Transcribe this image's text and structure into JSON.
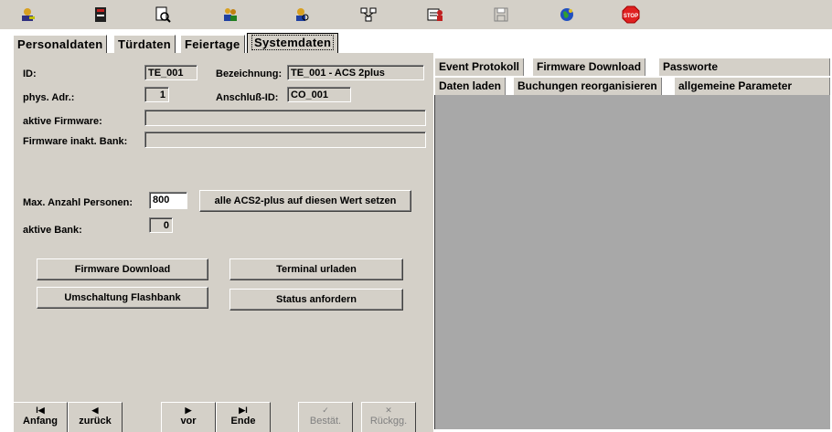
{
  "toolbar": {
    "icons": [
      "people-key-icon",
      "book-icon",
      "print-preview-icon",
      "persons-icon",
      "person-search-icon",
      "network-icon",
      "user-card-icon",
      "save-disk-icon",
      "globe-icon",
      "stop-icon"
    ],
    "stop_label": "STOP"
  },
  "tabs": [
    "Personaldaten",
    "Türdaten",
    "Feiertage",
    "Systemdaten"
  ],
  "form": {
    "id_label": "ID:",
    "id_value": "TE_001",
    "bez_label": "Bezeichnung:",
    "bez_value": "TE_001 - ACS 2plus",
    "phys_label": "phys. Adr.:",
    "phys_value": "1",
    "anschluss_label": "Anschluß-ID:",
    "anschluss_value": "CO_001",
    "firmware_label": "aktive Firmware:",
    "firmware_value": "",
    "firmware_inakt_label": "Firmware inakt. Bank:",
    "firmware_inakt_value": "",
    "max_label": "Max. Anzahl Personen:",
    "max_value": "800",
    "set_all_button": "alle ACS2-plus auf diesen Wert setzen",
    "bank_label": "aktive Bank:",
    "bank_value": "0"
  },
  "actions": {
    "firmware_download": "Firmware Download",
    "terminal_urladen": "Terminal urladen",
    "umschaltung": "Umschaltung Flashbank",
    "status": "Status anfordern"
  },
  "nav": [
    {
      "glyph": "I◀",
      "label": "Anfang",
      "enabled": true
    },
    {
      "glyph": "◀",
      "label": "zurück",
      "enabled": true
    },
    {
      "glyph": "▶",
      "label": "vor",
      "enabled": true
    },
    {
      "glyph": "▶I",
      "label": "Ende",
      "enabled": true
    },
    {
      "glyph": "✓",
      "label": "Bestät.",
      "enabled": false
    },
    {
      "glyph": "✕",
      "label": "Rückgg.",
      "enabled": false
    }
  ],
  "right_tabs_row1": [
    "Event Protokoll",
    "Firmware Download",
    "Passworte"
  ],
  "right_tabs_row2": [
    "Daten laden",
    "Buchungen reorganisieren",
    "allgemeine Parameter"
  ]
}
